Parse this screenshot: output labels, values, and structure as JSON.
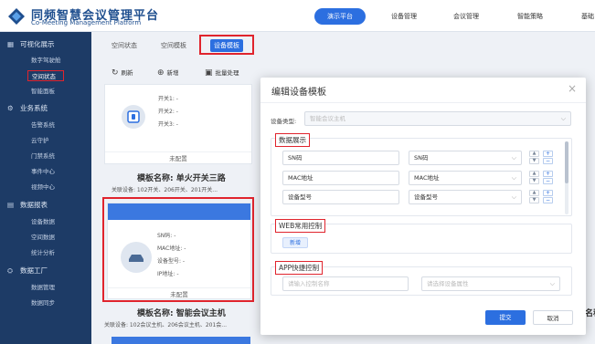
{
  "app": {
    "title": "同频智慧会议管理平台",
    "subtitle": "Co-Meeting Management Platform"
  },
  "topnav": [
    {
      "label": "演示平台",
      "active": true
    },
    {
      "label": "设备管理",
      "active": false
    },
    {
      "label": "会议管理",
      "active": false
    },
    {
      "label": "智能策略",
      "active": false
    },
    {
      "label": "基础",
      "active": false
    }
  ],
  "sidebar": {
    "groups": [
      {
        "label": "可视化展示",
        "icon": "grid-icon",
        "items": [
          "数字驾驶舱",
          "空间状态",
          "智能面板"
        ],
        "selected": "空间状态"
      },
      {
        "label": "业务系统",
        "icon": "settings-icon",
        "items": [
          "告警系统",
          "云守护",
          "门禁系统",
          "事件中心",
          "视频中心"
        ]
      },
      {
        "label": "数据报表",
        "icon": "report-icon",
        "items": [
          "设备数据",
          "空间数据",
          "统计分析"
        ]
      },
      {
        "label": "数据工厂",
        "icon": "factory-icon",
        "items": [
          "数据管理",
          "数据同步"
        ]
      }
    ]
  },
  "tabs": [
    {
      "label": "空间状态"
    },
    {
      "label": "空间模板"
    },
    {
      "label": "设备模板",
      "active": true
    }
  ],
  "toolbar": {
    "refresh": "刷新",
    "add": "新增",
    "batch": "批量处理"
  },
  "cards": {
    "card1": {
      "fields": [
        "开关1: -",
        "开关2: -",
        "开关3: -"
      ],
      "status": "未配置",
      "name": "模板名称: 单火开关三路",
      "relation": "关联设备: 102开关、206开关、201开关..."
    },
    "card2": {
      "fields": [
        "SN码: -",
        "MAC地址: -",
        "设备型号: -",
        "IP地址: -"
      ],
      "status": "未配置",
      "name": "模板名称: 智能会议主机",
      "relation": "关联设备: 102会议主机、206会议主机、201会..."
    },
    "peek_name": "名称"
  },
  "modal": {
    "title": "编辑设备模板",
    "close": "×",
    "device_type_label": "设备类型:",
    "device_type_value": "智能会议主机",
    "data_section": {
      "title": "数据展示",
      "rows": [
        {
          "label": "SN码",
          "field": "SN码"
        },
        {
          "label": "MAC地址",
          "field": "MAC地址"
        },
        {
          "label": "设备型号",
          "field": "设备型号"
        }
      ]
    },
    "web_section": {
      "title": "WEB常用控制",
      "add": "新增"
    },
    "app_section": {
      "title": "APP快捷控制",
      "name_placeholder": "请输入控制名称",
      "attr_placeholder": "请选择设备属性"
    },
    "submit": "提交",
    "cancel": "取消"
  },
  "colors": {
    "primary": "#2c6fe0",
    "sidebar": "#1d3b66",
    "highlight": "#e0242d"
  }
}
